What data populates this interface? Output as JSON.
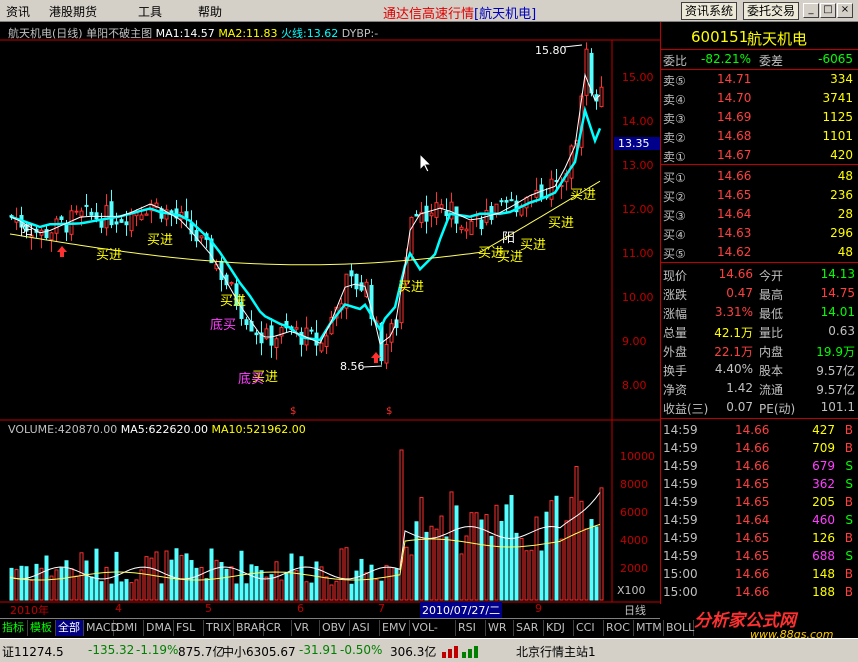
{
  "menu": {
    "items": [
      "资讯",
      "港股期货",
      "工具",
      "帮助"
    ],
    "title": "通达信高速行情",
    "stock_tag": "[航天机电]",
    "buttons": [
      "资讯系统",
      "委托交易"
    ]
  },
  "chart": {
    "header": {
      "name": "航天机电(日线)",
      "indicator": "单阳不破主图",
      "ma1": "MA1:14.57",
      "ma2": "MA2:11.83",
      "fire": "火线:13.62",
      "dybp": "DYBP:-"
    },
    "price_ticks": [
      "15.00",
      "14.00",
      "13.00",
      "12.00",
      "11.00",
      "10.00",
      "9.00",
      "8.00"
    ],
    "current_price_tag": "13.35",
    "high_label": "15.80",
    "low_label": "8.56",
    "signals": [
      "买进",
      "买进",
      "买进",
      "买进",
      "买进",
      "买进",
      "买进",
      "买进",
      "买进",
      "买进"
    ],
    "bottom_buys": [
      "底买",
      "底买"
    ],
    "yang_labels": [
      "阳",
      "阳"
    ],
    "volume_header": {
      "vol": "VOLUME:420870.00",
      "ma5": "MA5:622620.00",
      "ma10": "MA10:521962.00"
    },
    "volume_ticks": [
      "10000",
      "8000",
      "6000",
      "4000",
      "2000"
    ],
    "volume_unit": "X100",
    "date_axis": [
      "2010年",
      "4",
      "5",
      "6",
      "7",
      "2010/07/27/二",
      "9"
    ],
    "period": "日线"
  },
  "quote": {
    "code": "600151",
    "name": "航天机电",
    "weibi_label": "委比",
    "weibi": "-82.21%",
    "weicha_label": "委差",
    "weicha": "-6065",
    "asks": [
      {
        "l": "卖⑤",
        "p": "14.71",
        "v": "334"
      },
      {
        "l": "卖④",
        "p": "14.70",
        "v": "3741"
      },
      {
        "l": "卖③",
        "p": "14.69",
        "v": "1125"
      },
      {
        "l": "卖②",
        "p": "14.68",
        "v": "1101"
      },
      {
        "l": "卖①",
        "p": "14.67",
        "v": "420"
      }
    ],
    "bids": [
      {
        "l": "买①",
        "p": "14.66",
        "v": "48"
      },
      {
        "l": "买②",
        "p": "14.65",
        "v": "236"
      },
      {
        "l": "买③",
        "p": "14.64",
        "v": "28"
      },
      {
        "l": "买④",
        "p": "14.63",
        "v": "296"
      },
      {
        "l": "买⑤",
        "p": "14.62",
        "v": "48"
      }
    ],
    "stats": [
      {
        "a": "现价",
        "b": "14.66",
        "c": "今开",
        "d": "14.13"
      },
      {
        "a": "涨跌",
        "b": "0.47",
        "c": "最高",
        "d": "14.75"
      },
      {
        "a": "涨幅",
        "b": "3.31%",
        "c": "最低",
        "d": "14.01"
      },
      {
        "a": "总量",
        "b": "42.1万",
        "c": "量比",
        "d": "0.63"
      },
      {
        "a": "外盘",
        "b": "22.1万",
        "c": "内盘",
        "d": "19.9万"
      },
      {
        "a": "换手",
        "b": "4.40%",
        "c": "股本",
        "d": "9.57亿"
      },
      {
        "a": "净资",
        "b": "1.42",
        "c": "流通",
        "d": "9.57亿"
      },
      {
        "a": "收益(三)",
        "b": "0.07",
        "c": "PE(动)",
        "d": "101.1"
      }
    ],
    "ticks": [
      {
        "t": "14:59",
        "p": "14.66",
        "v": "427",
        "s": "B"
      },
      {
        "t": "14:59",
        "p": "14.66",
        "v": "709",
        "s": "B"
      },
      {
        "t": "14:59",
        "p": "14.66",
        "v": "679",
        "s": "S"
      },
      {
        "t": "14:59",
        "p": "14.65",
        "v": "362",
        "s": "S"
      },
      {
        "t": "14:59",
        "p": "14.65",
        "v": "205",
        "s": "B"
      },
      {
        "t": "14:59",
        "p": "14.64",
        "v": "460",
        "s": "S"
      },
      {
        "t": "14:59",
        "p": "14.65",
        "v": "126",
        "s": "B"
      },
      {
        "t": "14:59",
        "p": "14.65",
        "v": "688",
        "s": "S"
      },
      {
        "t": "15:00",
        "p": "14.66",
        "v": "148",
        "s": "B"
      },
      {
        "t": "15:00",
        "p": "14.66",
        "v": "188",
        "s": "B"
      }
    ]
  },
  "tabs": [
    "指标",
    "模板",
    "全部",
    "MACD",
    "DMI",
    "DMA",
    "FSL",
    "TRIX",
    "BRAR",
    "CR",
    "VR",
    "OBV",
    "ASI",
    "EMV",
    "VOL-TDX",
    "RSI",
    "WR",
    "SAR",
    "KDJ",
    "CCI",
    "ROC",
    "MTM",
    "BOLL"
  ],
  "status": {
    "index": "证11274.5",
    "chg": "-135.32",
    "pct": "-1.19%",
    "amt": "875.7亿",
    "index2": "中小6305.67",
    "chg2": "-31.91",
    "pct2": "-0.50%",
    "amt2": "306.3亿",
    "server": "北京行情主站1"
  },
  "logo": {
    "text": "分析家公式网",
    "url": "www.88gs.com"
  }
}
